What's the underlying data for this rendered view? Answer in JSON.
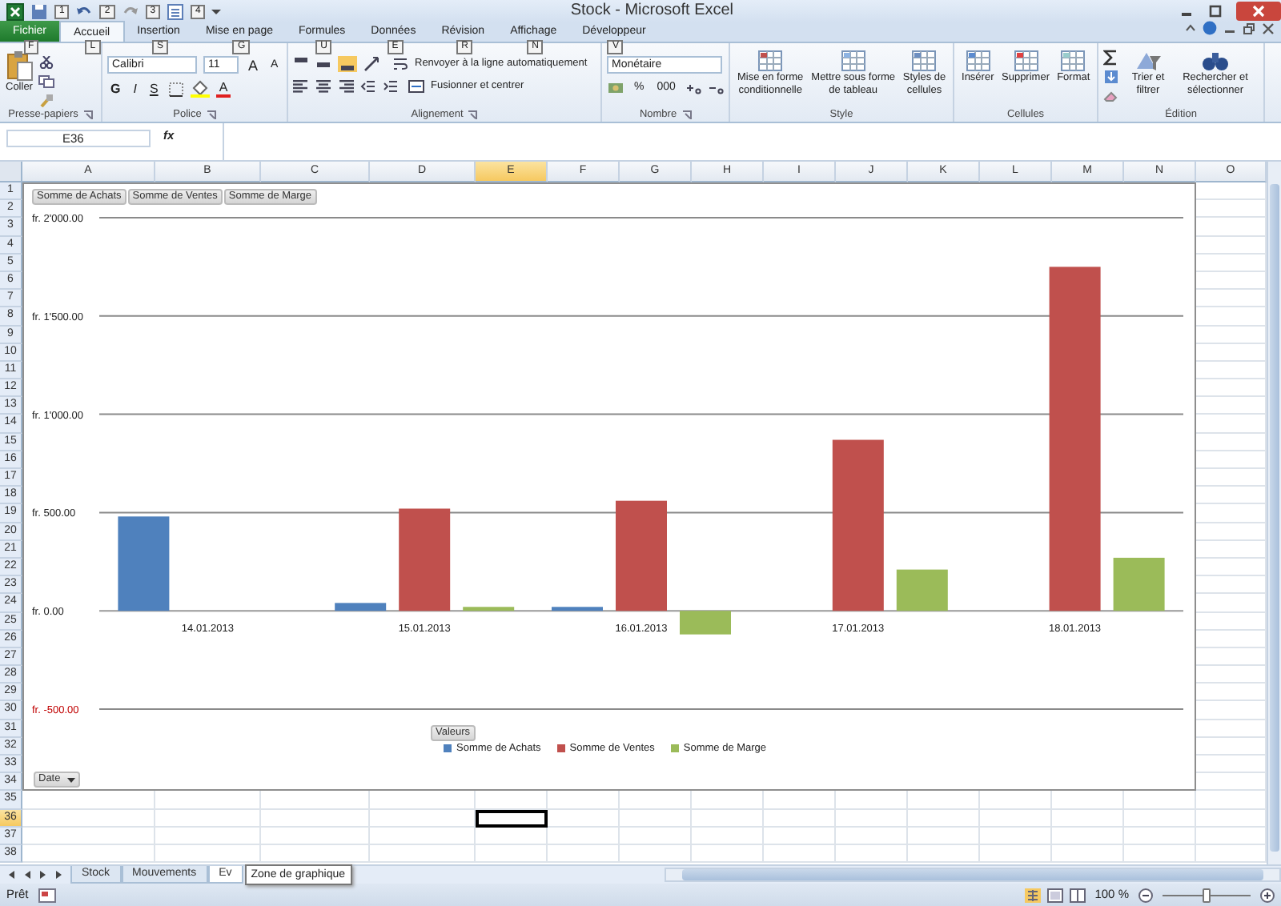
{
  "window": {
    "title": "Stock - Microsoft Excel",
    "quick_access_keytips": [
      "1",
      "2",
      "3",
      "4"
    ]
  },
  "tabs": [
    {
      "label": "Fichier",
      "keytip": "F",
      "kind": "backstage",
      "selected": false
    },
    {
      "label": "Accueil",
      "keytip": "L",
      "kind": "tab",
      "selected": true
    },
    {
      "label": "Insertion",
      "keytip": "S",
      "kind": "tab",
      "selected": false
    },
    {
      "label": "Mise en page",
      "keytip": "G",
      "kind": "tab",
      "selected": false
    },
    {
      "label": "Formules",
      "keytip": "U",
      "kind": "tab",
      "selected": false
    },
    {
      "label": "Données",
      "keytip": "E",
      "kind": "tab",
      "selected": false
    },
    {
      "label": "Révision",
      "keytip": "R",
      "kind": "tab",
      "selected": false
    },
    {
      "label": "Affichage",
      "keytip": "N",
      "kind": "tab",
      "selected": false
    },
    {
      "label": "Développeur",
      "keytip": "V",
      "kind": "tab",
      "selected": false
    }
  ],
  "ribbon": [
    {
      "kind": "clipboard",
      "label": "Presse-papiers",
      "paste": "Coller"
    },
    {
      "kind": "font",
      "label": "Police",
      "font": "Calibri",
      "size": "11",
      "grow": "A",
      "shrink": "A",
      "bold": "G",
      "italic": "I",
      "underline": "S",
      "font_color": "A"
    },
    {
      "kind": "alignment",
      "label": "Alignement",
      "wrap": "Renvoyer à la ligne automatiquement",
      "merge": "Fusionner et centrer"
    },
    {
      "kind": "number",
      "label": "Nombre",
      "format": "Monétaire",
      "percent": "%",
      "thousands": "000"
    },
    {
      "kind": "buttons",
      "label": "Style",
      "buttons": [
        "Mise en forme conditionnelle",
        "Mettre sous forme de tableau",
        "Styles de cellules"
      ]
    },
    {
      "kind": "buttons",
      "label": "Cellules",
      "buttons": [
        "Insérer",
        "Supprimer",
        "Format"
      ]
    },
    {
      "kind": "editing",
      "label": "Édition",
      "buttons": [
        "Trier et filtrer",
        "Rechercher et sélectionner"
      ]
    }
  ],
  "formula_bar": {
    "name_box": "E36",
    "function_label": "fx"
  },
  "sheet": {
    "columns": [
      {
        "label": "A",
        "selected": false
      },
      {
        "label": "B",
        "selected": false
      },
      {
        "label": "C",
        "selected": false
      },
      {
        "label": "D",
        "selected": false
      },
      {
        "label": "E",
        "selected": true
      },
      {
        "label": "F",
        "selected": false
      },
      {
        "label": "G",
        "selected": false
      },
      {
        "label": "H",
        "selected": false
      },
      {
        "label": "I",
        "selected": false
      },
      {
        "label": "J",
        "selected": false
      },
      {
        "label": "K",
        "selected": false
      },
      {
        "label": "L",
        "selected": false
      },
      {
        "label": "M",
        "selected": false
      },
      {
        "label": "N",
        "selected": false
      },
      {
        "label": "O",
        "selected": false
      }
    ],
    "rows": [
      {
        "label": "1",
        "selected": false
      },
      {
        "label": "2",
        "selected": false
      },
      {
        "label": "3",
        "selected": false
      },
      {
        "label": "4",
        "selected": false
      },
      {
        "label": "5",
        "selected": false
      },
      {
        "label": "6",
        "selected": false
      },
      {
        "label": "7",
        "selected": false
      },
      {
        "label": "8",
        "selected": false
      },
      {
        "label": "9",
        "selected": false
      },
      {
        "label": "10",
        "selected": false
      },
      {
        "label": "11",
        "selected": false
      },
      {
        "label": "12",
        "selected": false
      },
      {
        "label": "13",
        "selected": false
      },
      {
        "label": "14",
        "selected": false
      },
      {
        "label": "15",
        "selected": false
      },
      {
        "label": "16",
        "selected": false
      },
      {
        "label": "17",
        "selected": false
      },
      {
        "label": "18",
        "selected": false
      },
      {
        "label": "19",
        "selected": false
      },
      {
        "label": "20",
        "selected": false
      },
      {
        "label": "21",
        "selected": false
      },
      {
        "label": "22",
        "selected": false
      },
      {
        "label": "23",
        "selected": false
      },
      {
        "label": "24",
        "selected": false
      },
      {
        "label": "25",
        "selected": false
      },
      {
        "label": "26",
        "selected": false
      },
      {
        "label": "27",
        "selected": false
      },
      {
        "label": "28",
        "selected": false
      },
      {
        "label": "29",
        "selected": false
      },
      {
        "label": "30",
        "selected": false
      },
      {
        "label": "31",
        "selected": false
      },
      {
        "label": "32",
        "selected": false
      },
      {
        "label": "33",
        "selected": false
      },
      {
        "label": "34",
        "selected": false
      },
      {
        "label": "35",
        "selected": false
      },
      {
        "label": "36",
        "selected": true
      },
      {
        "label": "37",
        "selected": false
      },
      {
        "label": "38",
        "selected": false
      }
    ]
  },
  "chart": {
    "field_buttons": [
      "Somme de Achats",
      "Somme de Ventes",
      "Somme de Marge"
    ],
    "values_button": "Valeurs",
    "axis_button": "Date",
    "chart_data": {
      "type": "bar",
      "categories": [
        "14.01.2013",
        "15.01.2013",
        "16.01.2013",
        "17.01.2013",
        "18.01.2013"
      ],
      "series": [
        {
          "name": "Somme de Achats",
          "color": "#4f81bd",
          "values": [
            480,
            40,
            20,
            null,
            null
          ]
        },
        {
          "name": "Somme de Ventes",
          "color": "#c0504d",
          "values": [
            null,
            520,
            560,
            870,
            1750
          ]
        },
        {
          "name": "Somme de Marge",
          "color": "#9bbb59",
          "values": [
            null,
            20,
            -120,
            210,
            270
          ]
        }
      ],
      "ylim": [
        -500,
        2000
      ],
      "yticks": [
        {
          "value": 2000,
          "label": "fr. 2'000.00"
        },
        {
          "value": 1500,
          "label": "fr. 1'500.00"
        },
        {
          "value": 1000,
          "label": "fr. 1'000.00"
        },
        {
          "value": 500,
          "label": "fr. 500.00"
        },
        {
          "value": 0,
          "label": "fr. 0.00"
        },
        {
          "value": -500,
          "label": "fr. -500.00"
        }
      ],
      "grid": true,
      "legend": true
    }
  },
  "sheet_tabs": [
    {
      "label": "Stock",
      "selected": false
    },
    {
      "label": "Mouvements",
      "selected": false
    },
    {
      "label": "Ev",
      "selected": true
    }
  ],
  "tooltip": "Zone de graphique",
  "status_bar": {
    "status": "Prêt",
    "zoom": "100 %",
    "zoom_slider": {
      "level": 0.5
    }
  }
}
